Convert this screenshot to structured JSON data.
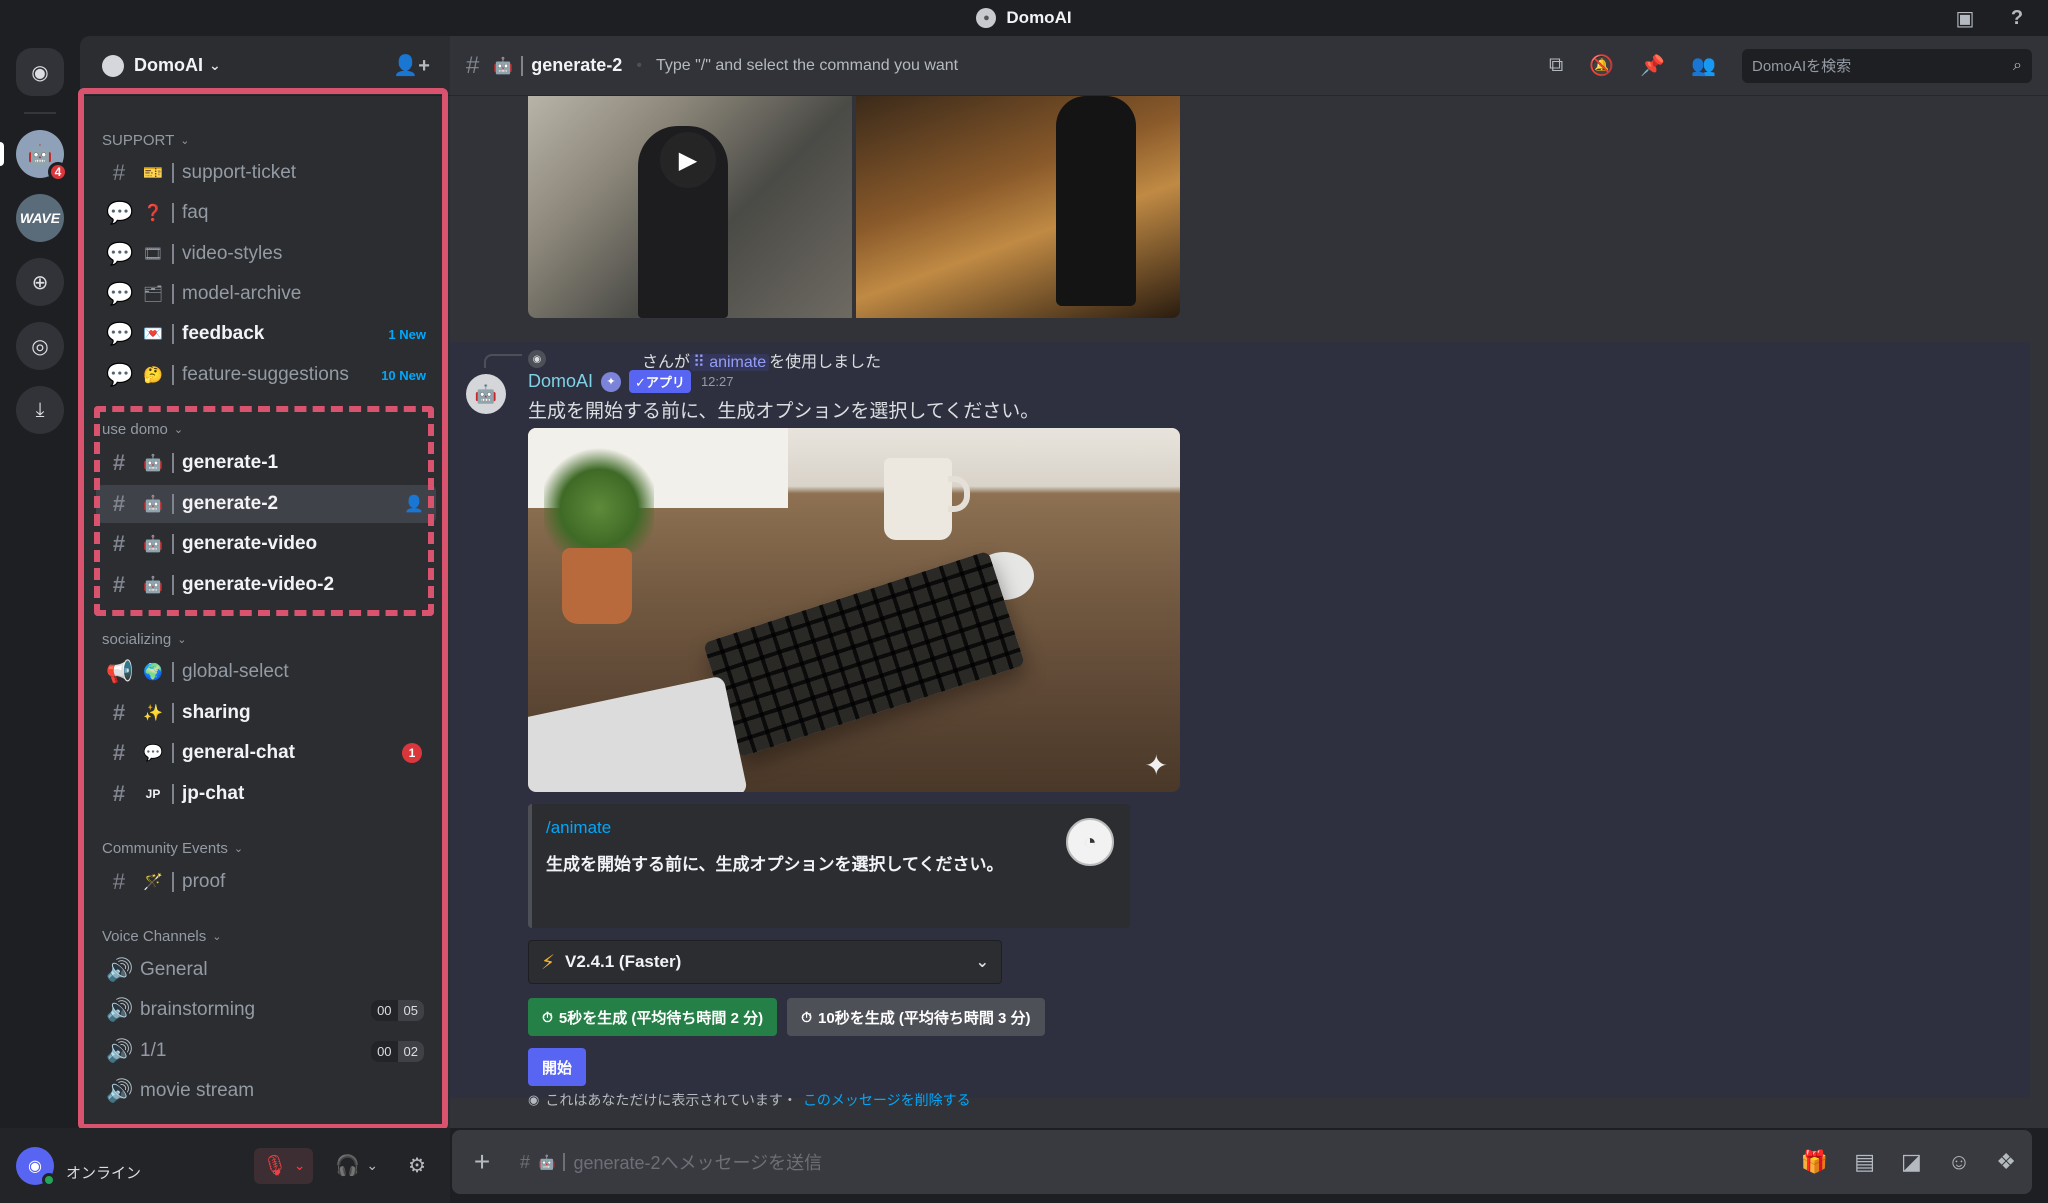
{
  "window": {
    "title": "DomoAI"
  },
  "server": {
    "name": "DomoAI"
  },
  "rail": {
    "badge_count": "4",
    "wave_label": "WAVE"
  },
  "categories": {
    "support": "SUPPORT",
    "use_domo": "use domo",
    "socializing": "socializing",
    "community_events": "Community Events",
    "voice_channels": "Voice Channels"
  },
  "channels": {
    "support_ticket": "support-ticket",
    "faq": "faq",
    "video_styles": "video-styles",
    "model_archive": "model-archive",
    "feedback": "feedback",
    "feedback_new": "1 New",
    "feature_suggestions": "feature-suggestions",
    "feature_suggestions_new": "10 New",
    "generate_1": "generate-1",
    "generate_2": "generate-2",
    "generate_video": "generate-video",
    "generate_video_2": "generate-video-2",
    "global_select": "global-select",
    "sharing": "sharing",
    "general_chat": "general-chat",
    "general_chat_badge": "1",
    "jp_chat": "jp-chat",
    "jp_prefix": "JP",
    "proof": "proof",
    "general_voice": "General",
    "brainstorming": "brainstorming",
    "brainstorming_count_a": "00",
    "brainstorming_count_b": "05",
    "one_on_one": "1/1",
    "one_on_one_count_a": "00",
    "one_on_one_count_b": "02",
    "movie_stream": "movie stream"
  },
  "user": {
    "status": "オンライン"
  },
  "header": {
    "channel": "generate-2",
    "topic": "Type \"/\" and select the command you want",
    "search_placeholder": "DomoAIを検索"
  },
  "message": {
    "reply_prefix": "さんが",
    "reply_command": "animate",
    "reply_suffix": "を使用しました",
    "author": "DomoAI",
    "app_tag": "✓アプリ",
    "time": "12:27",
    "body": "生成を開始する前に、生成オプションを選択してください。",
    "embed_command": "/animate",
    "embed_desc": "生成を開始する前に、生成オプションを選択してください。",
    "select_value": "V2.4.1 (Faster)",
    "btn_5s": "5秒を生成 (平均待ち時間 2 分)",
    "btn_10s": "10秒を生成 (平均待ち時間 3 分)",
    "btn_start": "開始",
    "ephemeral_text": "これはあなただけに表示されています・",
    "ephemeral_link": "このメッセージを削除する"
  },
  "composer": {
    "placeholder": "generate-2へメッセージを送信"
  },
  "colors": {
    "highlight": "#d9536e",
    "link": "#00a8fc",
    "green_button": "#248046",
    "blurple": "#5865f2"
  },
  "icons": [
    "discord-icon",
    "search-icon",
    "pin-icon",
    "members-icon",
    "threads-icon",
    "mute-icon",
    "headphones-icon",
    "gear-icon",
    "gift-icon",
    "gif-icon",
    "sticker-icon",
    "emoji-icon",
    "apps-icon",
    "speaker-icon",
    "announcement-icon",
    "forum-icon",
    "play-icon",
    "bolt-icon",
    "eye-icon"
  ]
}
